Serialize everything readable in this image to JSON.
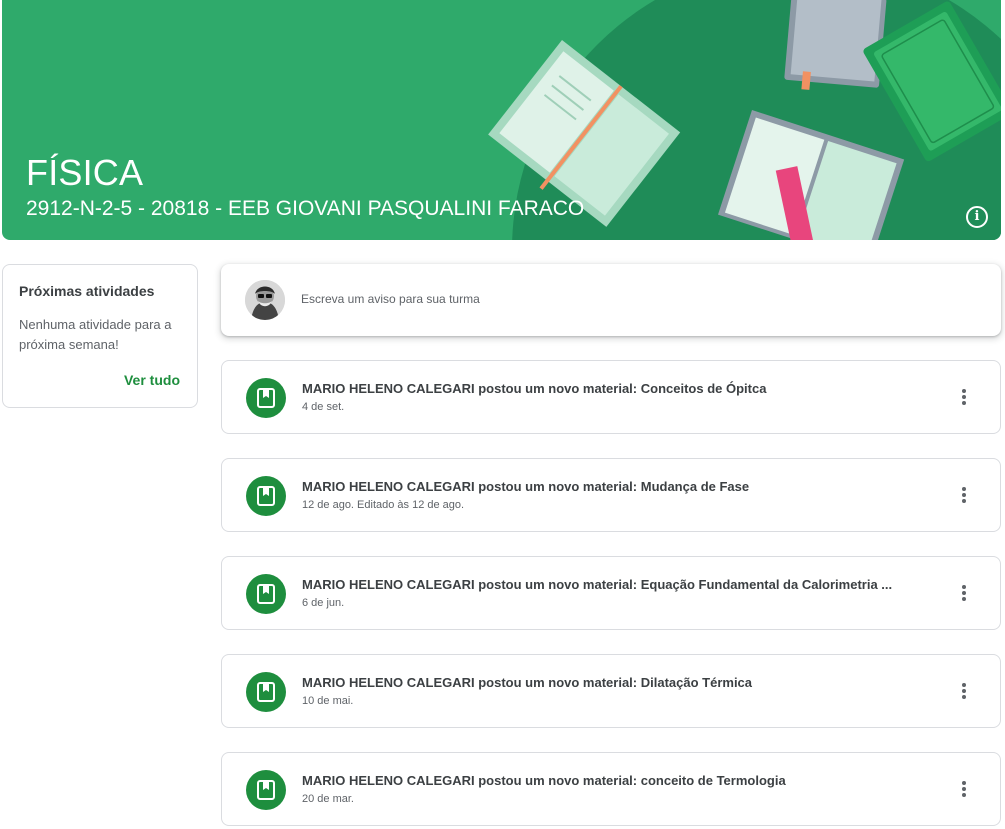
{
  "header": {
    "title": "FÍSICA",
    "subtitle": "2912-N-2-5 - 20818 - EEB GIOVANI PASQUALINI FARACO",
    "info_icon": "info-icon"
  },
  "upcoming": {
    "title": "Próximas atividades",
    "message": "Nenhuma atividade para a próxima semana!",
    "see_all": "Ver tudo"
  },
  "composer": {
    "placeholder": "Escreva um aviso para sua turma"
  },
  "posts": [
    {
      "title": "MARIO HELENO CALEGARI postou um novo material: Conceitos de Ópitca",
      "date": "4 de set.",
      "icon": "material-icon"
    },
    {
      "title": "MARIO HELENO CALEGARI postou um novo material: Mudança de Fase",
      "date": "12 de ago. Editado às 12 de ago.",
      "icon": "material-icon"
    },
    {
      "title": "MARIO HELENO CALEGARI postou um novo material: Equação Fundamental da Calorimetria ...",
      "date": "6 de jun.",
      "icon": "material-icon"
    },
    {
      "title": "MARIO HELENO CALEGARI postou um novo material: Dilatação Térmica",
      "date": "10 de mai.",
      "icon": "material-icon"
    },
    {
      "title": "MARIO HELENO CALEGARI postou um novo material: conceito de Termologia",
      "date": "20 de mar.",
      "icon": "material-icon"
    }
  ],
  "colors": {
    "banner": "#2faa6b",
    "accent": "#1e8e3e"
  }
}
